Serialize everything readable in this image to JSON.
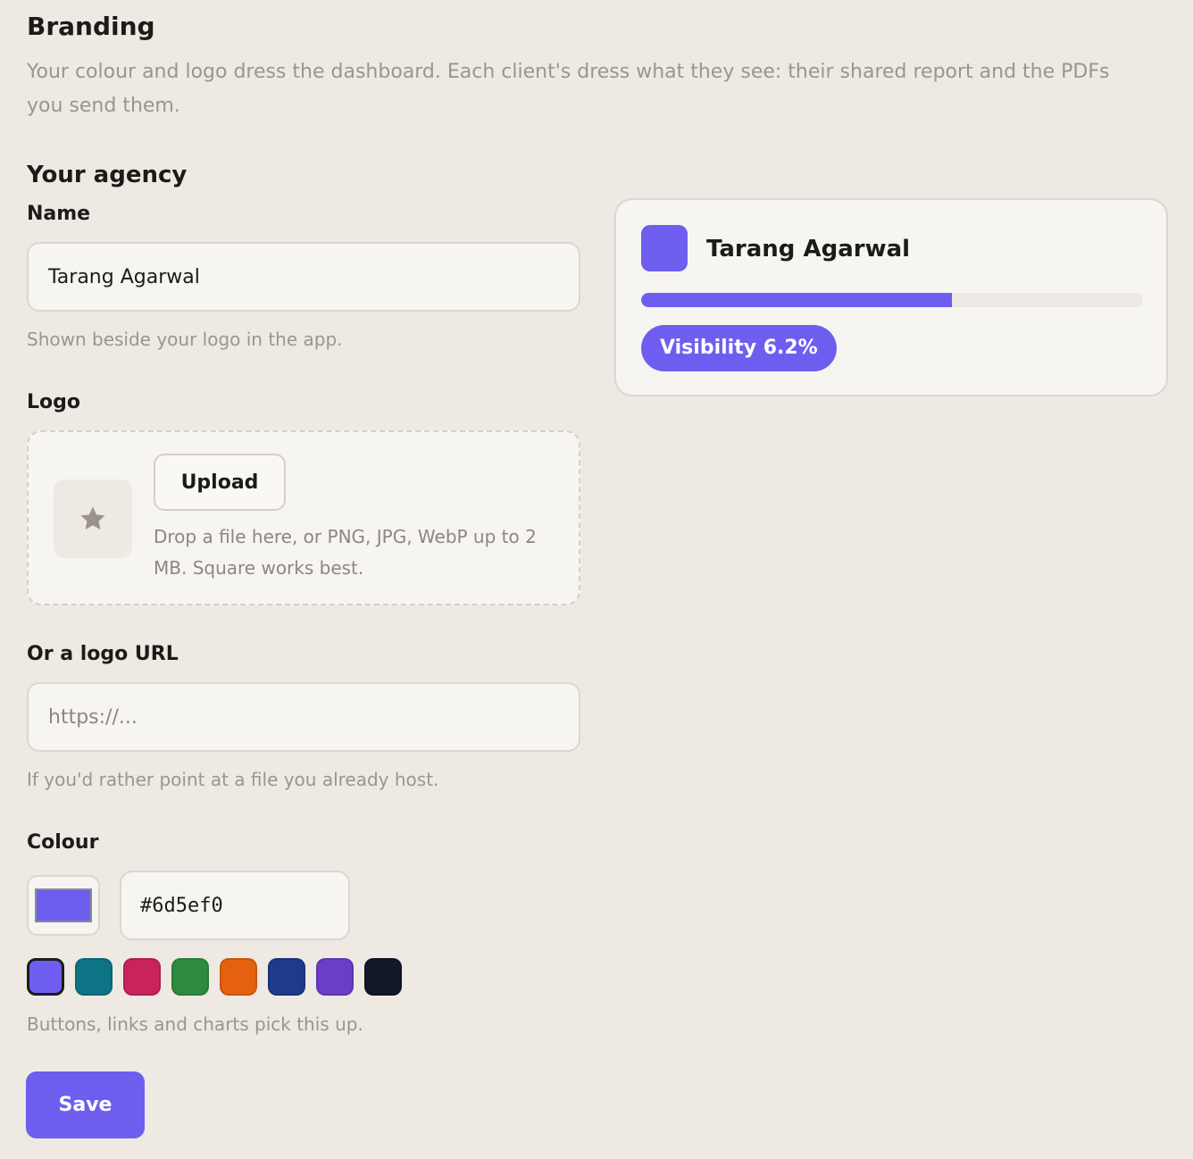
{
  "header": {
    "title": "Branding",
    "description": "Your colour and logo dress the dashboard. Each client's dress what they see: their shared report and the PDFs you send them."
  },
  "agency": {
    "section_title": "Your agency",
    "name_label": "Name",
    "name_value": "Tarang Agarwal",
    "name_hint": "Shown beside your logo in the app.",
    "logo_label": "Logo",
    "logo_placeholder_icon": "star-icon",
    "upload_label": "Upload",
    "drop_hint": "Drop a file here, or PNG, JPG, WebP up to 2 MB. Square works best.",
    "logo_url_label": "Or a logo URL",
    "logo_url_value": "",
    "logo_url_placeholder": "https://...",
    "logo_url_hint": "If you'd rather point at a file you already host.",
    "colour_label": "Colour",
    "colour_value": "#6d5ef0",
    "colour_hint": "Buttons, links and charts pick this up.",
    "presets": [
      "#6d5ef0",
      "#0e7385",
      "#c8235a",
      "#2e8b3e",
      "#e5610f",
      "#1e3a8a",
      "#6a3ec7",
      "#111827"
    ],
    "selected_preset": 0,
    "save_label": "Save"
  },
  "preview": {
    "name": "Tarang Agarwal",
    "progress_fraction": 0.62,
    "badge_label": "Visibility 6.2%"
  },
  "colors": {
    "accent": "#6d5ef0",
    "background": "#eee9e3",
    "card": "#f7f5f1",
    "muted_text": "#9a958f"
  }
}
